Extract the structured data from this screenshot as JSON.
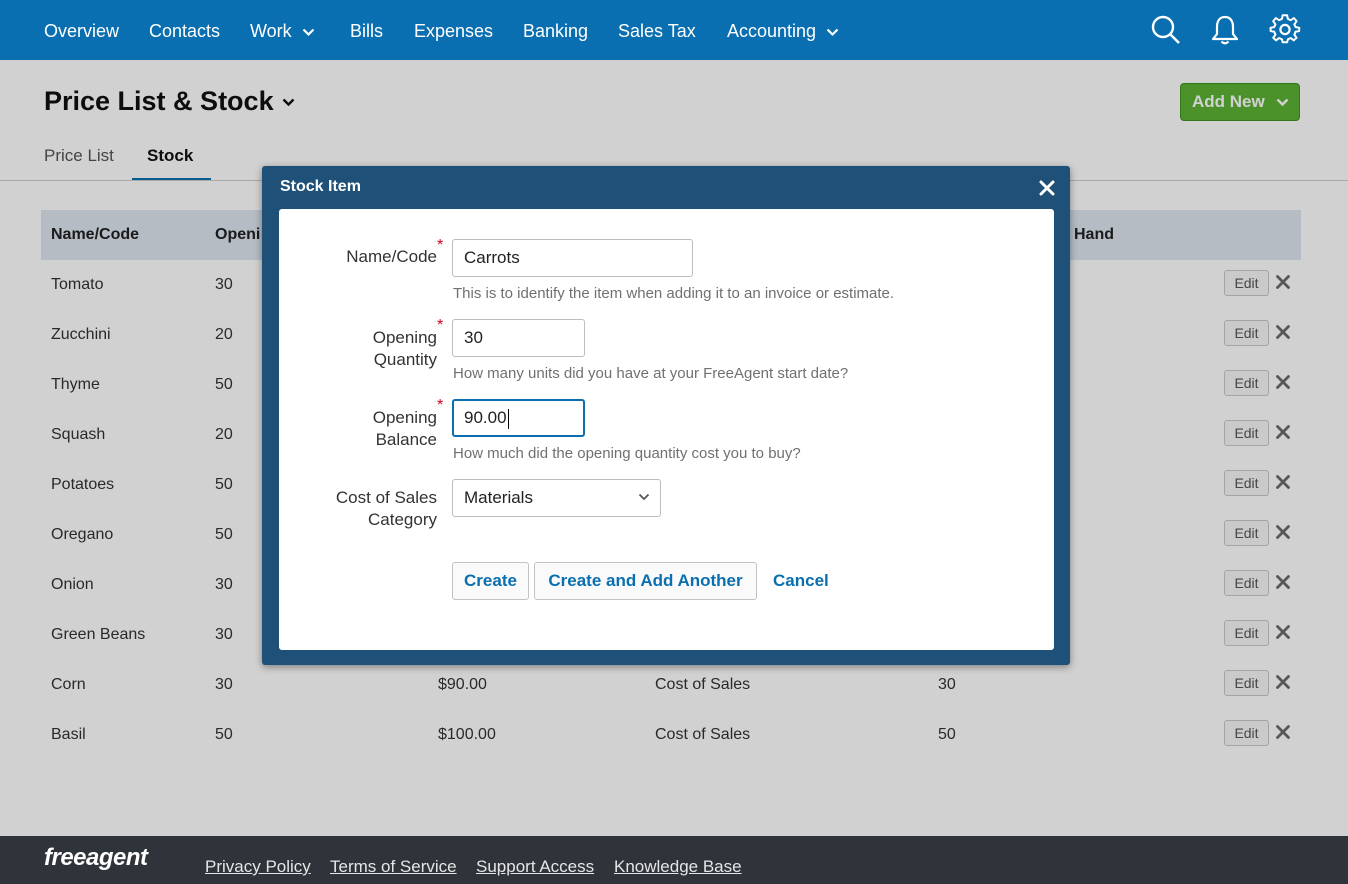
{
  "topnav": {
    "items": [
      {
        "label": "Overview"
      },
      {
        "label": "Contacts"
      },
      {
        "label": "Work"
      },
      {
        "label": "Bills"
      },
      {
        "label": "Expenses"
      },
      {
        "label": "Banking"
      },
      {
        "label": "Sales Tax"
      },
      {
        "label": "Accounting"
      }
    ],
    "icons": [
      "search-icon",
      "bell-icon",
      "gear-icon"
    ]
  },
  "page": {
    "title": "Price List & Stock",
    "add_new_label": "Add New",
    "tabs": [
      {
        "label": "Price List",
        "active": false
      },
      {
        "label": "Stock",
        "active": true
      }
    ]
  },
  "table": {
    "headers": [
      "Name/Code",
      "Openi",
      "Hand"
    ],
    "edit_label": "Edit",
    "rows": [
      {
        "name": "Tomato",
        "opening": "30",
        "balance": "",
        "category": "",
        "on_hand": ""
      },
      {
        "name": "Zucchini",
        "opening": "20",
        "balance": "",
        "category": "",
        "on_hand": ""
      },
      {
        "name": "Thyme",
        "opening": "50",
        "balance": "",
        "category": "",
        "on_hand": ""
      },
      {
        "name": "Squash",
        "opening": "20",
        "balance": "",
        "category": "",
        "on_hand": ""
      },
      {
        "name": "Potatoes",
        "opening": "50",
        "balance": "",
        "category": "",
        "on_hand": ""
      },
      {
        "name": "Oregano",
        "opening": "50",
        "balance": "",
        "category": "",
        "on_hand": ""
      },
      {
        "name": "Onion",
        "opening": "30",
        "balance": "",
        "category": "",
        "on_hand": ""
      },
      {
        "name": "Green Beans",
        "opening": "30",
        "balance": "",
        "category": "",
        "on_hand": ""
      },
      {
        "name": "Corn",
        "opening": "30",
        "balance": "$90.00",
        "category": "Cost of Sales",
        "on_hand": "30"
      },
      {
        "name": "Basil",
        "opening": "50",
        "balance": "$100.00",
        "category": "Cost of Sales",
        "on_hand": "50"
      }
    ]
  },
  "modal": {
    "title": "Stock Item",
    "fields": {
      "name": {
        "label": "Name/Code",
        "value": "Carrots",
        "help": "This is to identify the item when adding it to an invoice or estimate."
      },
      "opening_quantity": {
        "label_line1": "Opening",
        "label_line2": "Quantity",
        "value": "30",
        "help": "How many units did you have at your FreeAgent start date?"
      },
      "opening_balance": {
        "label_line1": "Opening",
        "label_line2": "Balance",
        "value": "90.00",
        "help": "How much did the opening quantity cost you to buy?"
      },
      "category": {
        "label_line1": "Cost of Sales",
        "label_line2": "Category",
        "value": "Materials"
      }
    },
    "required_mark": "*",
    "buttons": {
      "create": "Create",
      "create_another": "Create and Add Another",
      "cancel": "Cancel"
    }
  },
  "footer": {
    "logo": "freeagent",
    "links": [
      "Privacy Policy",
      "Terms of Service",
      "Support Access",
      "Knowledge Base"
    ]
  },
  "colors": {
    "nav_blue": "#0a6fb0",
    "modal_header": "#1f5178",
    "add_new_green": "#5cb335",
    "footer_bg": "#2e3439",
    "required_red": "#d0021b"
  }
}
